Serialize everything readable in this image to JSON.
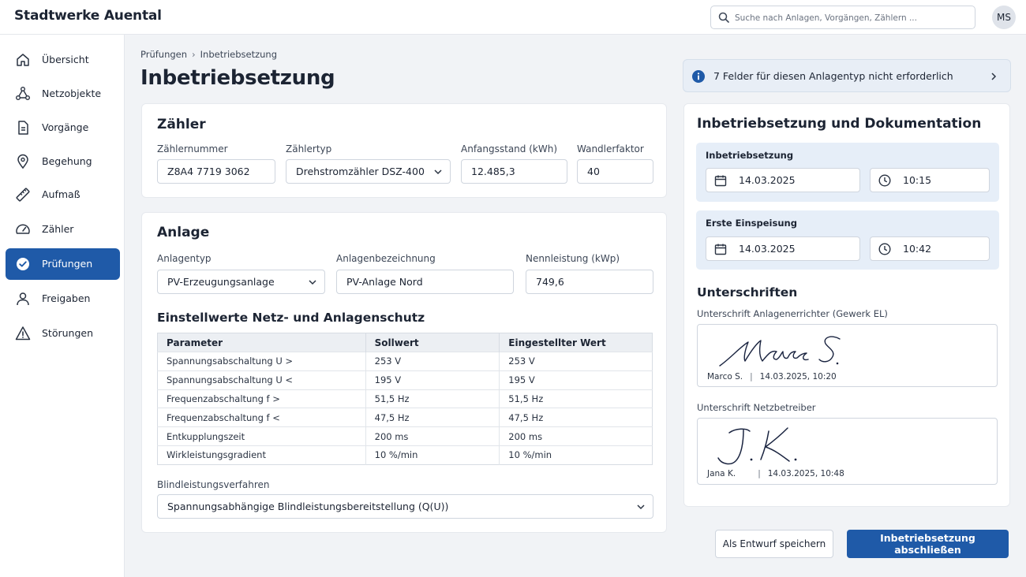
{
  "header": {
    "brand": "Stadtwerke Auental",
    "search_placeholder": "Suche nach Anlagen, Vorgängen, Zählern ...",
    "avatar_initials": "MS"
  },
  "sidebar": {
    "items": [
      {
        "label": "Übersicht",
        "icon": "home-icon"
      },
      {
        "label": "Netzobjekte",
        "icon": "network-icon"
      },
      {
        "label": "Vorgänge",
        "icon": "document-icon"
      },
      {
        "label": "Begehung",
        "icon": "location-pin-icon"
      },
      {
        "label": "Aufmaß",
        "icon": "ruler-icon"
      },
      {
        "label": "Zähler",
        "icon": "gauge-icon"
      },
      {
        "label": "Prüfungen",
        "icon": "check-circle-icon",
        "active": true
      },
      {
        "label": "Freigaben",
        "icon": "user-icon"
      },
      {
        "label": "Störungen",
        "icon": "warning-icon"
      }
    ],
    "accent": "#1f5aa8"
  },
  "breadcrumb": {
    "parent": "Prüfungen",
    "current": "Inbetriebsetzung"
  },
  "page_title": "Inbetriebsetzung",
  "zaehler": {
    "title": "Zähler",
    "zaehlernummer": {
      "label": "Zählernummer",
      "value": "Z8A4 7719 3062"
    },
    "zaehlertyp": {
      "label": "Zählertyp",
      "value": "Drehstromzähler DSZ-400"
    },
    "anfangsstand": {
      "label": "Anfangsstand (kWh)",
      "value": "12.485,3"
    },
    "wandlerfaktor": {
      "label": "Wandlerfaktor",
      "value": "40"
    }
  },
  "anlage": {
    "title": "Anlage",
    "anlagentyp": {
      "label": "Anlagentyp",
      "value": "PV-Erzeugungsanlage"
    },
    "bezeichnung": {
      "label": "Anlagenbezeichnung",
      "value": "PV-Anlage Nord"
    },
    "nennleistung": {
      "label": "Nennleistung (kWp)",
      "value": "749,6"
    },
    "schutz_title": "Einstellwerte Netz- und Anlagenschutz",
    "table": {
      "headers": [
        "Parameter",
        "Sollwert",
        "Eingestellter Wert"
      ],
      "rows": [
        [
          "Spannungsabschaltung U >",
          "253 V",
          "253 V"
        ],
        [
          "Spannungsabschaltung U <",
          "195 V",
          "195 V"
        ],
        [
          "Frequenzabschaltung f >",
          "51,5 Hz",
          "51,5 Hz"
        ],
        [
          "Frequenzabschaltung f <",
          "47,5 Hz",
          "47,5 Hz"
        ],
        [
          "Entkupplungszeit",
          "200 ms",
          "200 ms"
        ],
        [
          "Wirkleistungsgradient",
          "10 %/min",
          "10 %/min"
        ]
      ]
    },
    "blindleistung": {
      "label": "Blindleistungsverfahren",
      "value": "Spannungsabhängige Blindleistungsbereitstellung (Q(U))"
    }
  },
  "banner": {
    "text": "7 Felder für diesen Anlagentyp nicht erforderlich"
  },
  "dokumentation": {
    "title": "Inbetriebsetzung und Dokumentation",
    "inbetriebsetzung": {
      "label": "Inbetriebsetzung",
      "date": "14.03.2025",
      "time": "10:15"
    },
    "einspeisung": {
      "label": "Erste Einspeisung",
      "date": "14.03.2025",
      "time": "10:42"
    },
    "signatures_title": "Unterschriften",
    "sig1": {
      "label": "Unterschrift Anlagenerrichter (Gewerk EL)",
      "name": "Marco S.",
      "timestamp": "14.03.2025, 10:20"
    },
    "sig2": {
      "label": "Unterschrift Netzbetreiber",
      "name": "Jana K.",
      "timestamp": "14.03.2025, 10:48"
    }
  },
  "actions": {
    "draft": "Als Entwurf speichern",
    "finish": "Inbetriebsetzung abschließen"
  }
}
